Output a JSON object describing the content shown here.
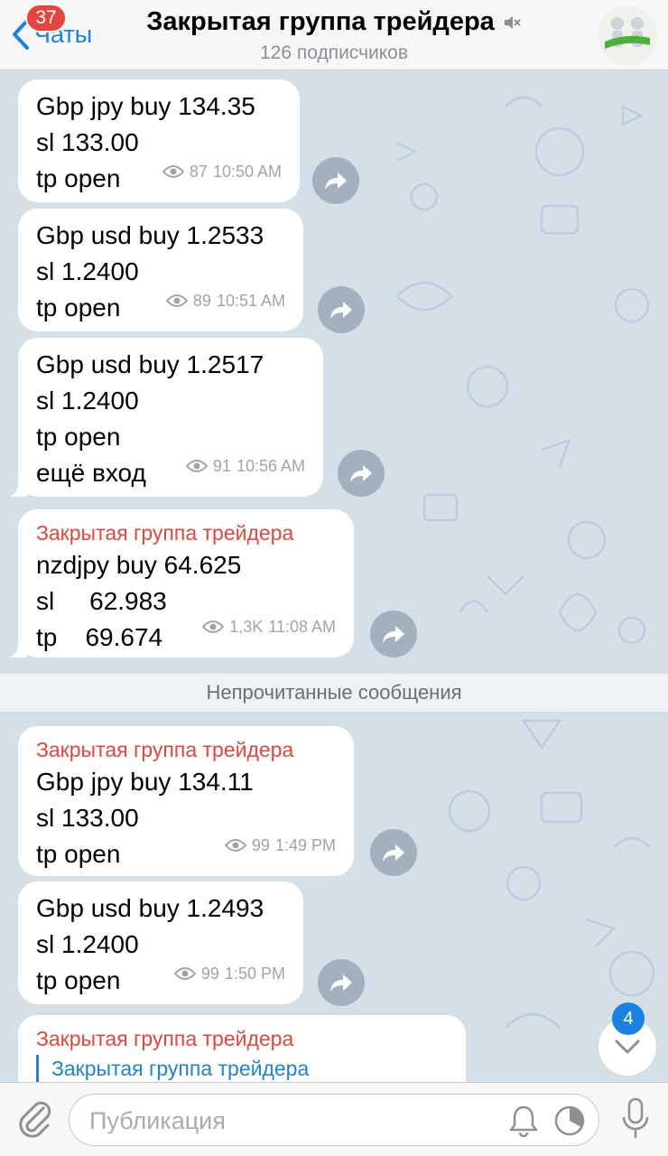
{
  "header": {
    "back_label": "Чаты",
    "unread_count": "37",
    "title": "Закрытая группа трейдера",
    "subtitle": "126 подписчиков"
  },
  "messages": [
    {
      "lines": [
        "Gbp jpy buy 134.35",
        "sl 133.00",
        "tp open"
      ],
      "views": "87",
      "time": "10:50 AM"
    },
    {
      "lines": [
        "Gbp usd buy 1.2533",
        "sl 1.2400",
        "tp open"
      ],
      "views": "89",
      "time": "10:51 AM"
    },
    {
      "lines": [
        "Gbp usd buy 1.2517",
        "sl 1.2400",
        "tp open",
        "ещё вход"
      ],
      "views": "91",
      "time": "10:56 AM"
    },
    {
      "sender": "Закрытая группа трейдера",
      "lines": [
        "nzdjpy buy 64.625",
        "sl     62.983",
        "tp    69.674"
      ],
      "views": "1,3K",
      "time": "11:08 AM"
    },
    {
      "sender": "Закрытая группа трейдера",
      "lines": [
        "Gbp jpy buy 134.11",
        "sl 133.00",
        "tp open"
      ],
      "views": "99",
      "time": "1:49 PM"
    },
    {
      "lines": [
        "Gbp usd buy 1.2493",
        "sl 1.2400",
        "tp open"
      ],
      "views": "99",
      "time": "1:50 PM"
    },
    {
      "sender": "Закрытая группа трейдера",
      "forwarded_from": "Закрытая группа трейдера"
    }
  ],
  "unread_divider": "Непрочитанные сообщения",
  "scroll_down_badge": "4",
  "input": {
    "placeholder": "Публикация"
  },
  "colors": {
    "accent": "#1a82e2",
    "sender": "#e0483d",
    "badge": "#e5453c",
    "chat_bg": "#d4dfe8"
  }
}
